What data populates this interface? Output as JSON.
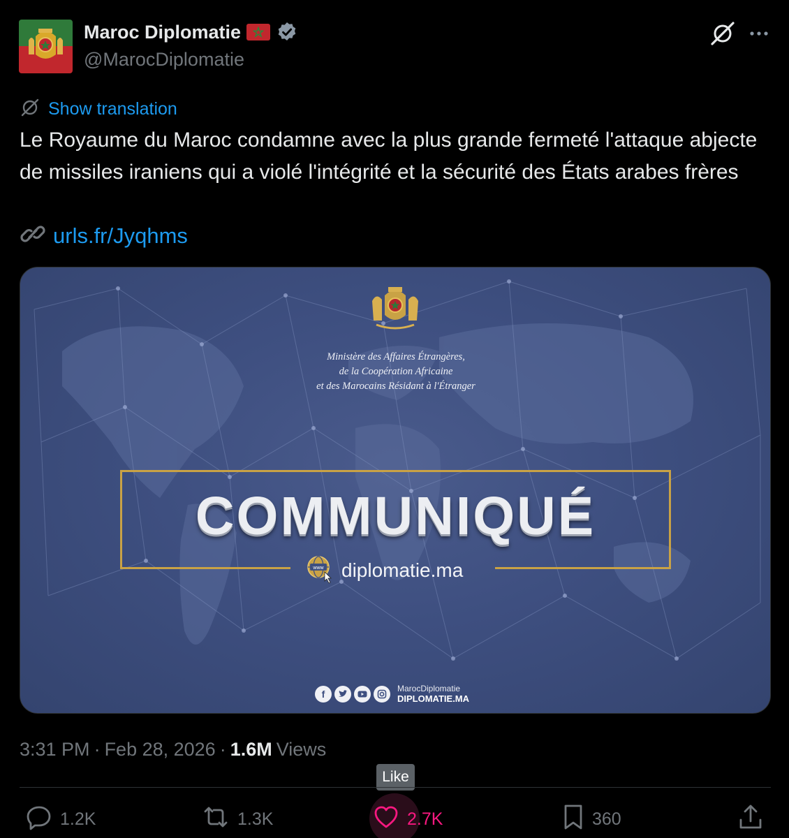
{
  "author": {
    "name": "Maroc Diplomatie",
    "handle": "@MarocDiplomatie"
  },
  "translate": {
    "label": "Show translation"
  },
  "tweet": {
    "text": "Le Royaume du Maroc condamne avec la plus grande fermeté l'attaque abjecte de missiles iraniens qui a violé l'intégrité et la sécurité des États arabes frères",
    "link": "urls.fr/Jyqhms"
  },
  "media": {
    "ministry_line1": "Ministère des Affaires Étrangères,",
    "ministry_line2": "de la Coopération Africaine",
    "ministry_line3": "et des Marocains Résidant à l'Étranger",
    "headline": "COMMUNIQUÉ",
    "website": "diplomatie.ma",
    "globe_text": "www",
    "social_handle": "MarocDiplomatie",
    "social_site": "DIPLOMATIE.MA"
  },
  "meta": {
    "time": "3:31 PM",
    "separator": "·",
    "date": "Feb 28, 2026",
    "views_count": "1.6M",
    "views_label": "Views"
  },
  "tooltip": {
    "label": "Like"
  },
  "actions": {
    "replies": "1.2K",
    "reposts": "1.3K",
    "likes": "2.7K",
    "bookmarks": "360"
  },
  "colors": {
    "background": "#000000",
    "link": "#1d9bf0",
    "like": "#f91880",
    "muted": "#71767b",
    "card_blue": "#3e4f80",
    "gold": "#c9a245",
    "flag_red": "#c1272d"
  }
}
